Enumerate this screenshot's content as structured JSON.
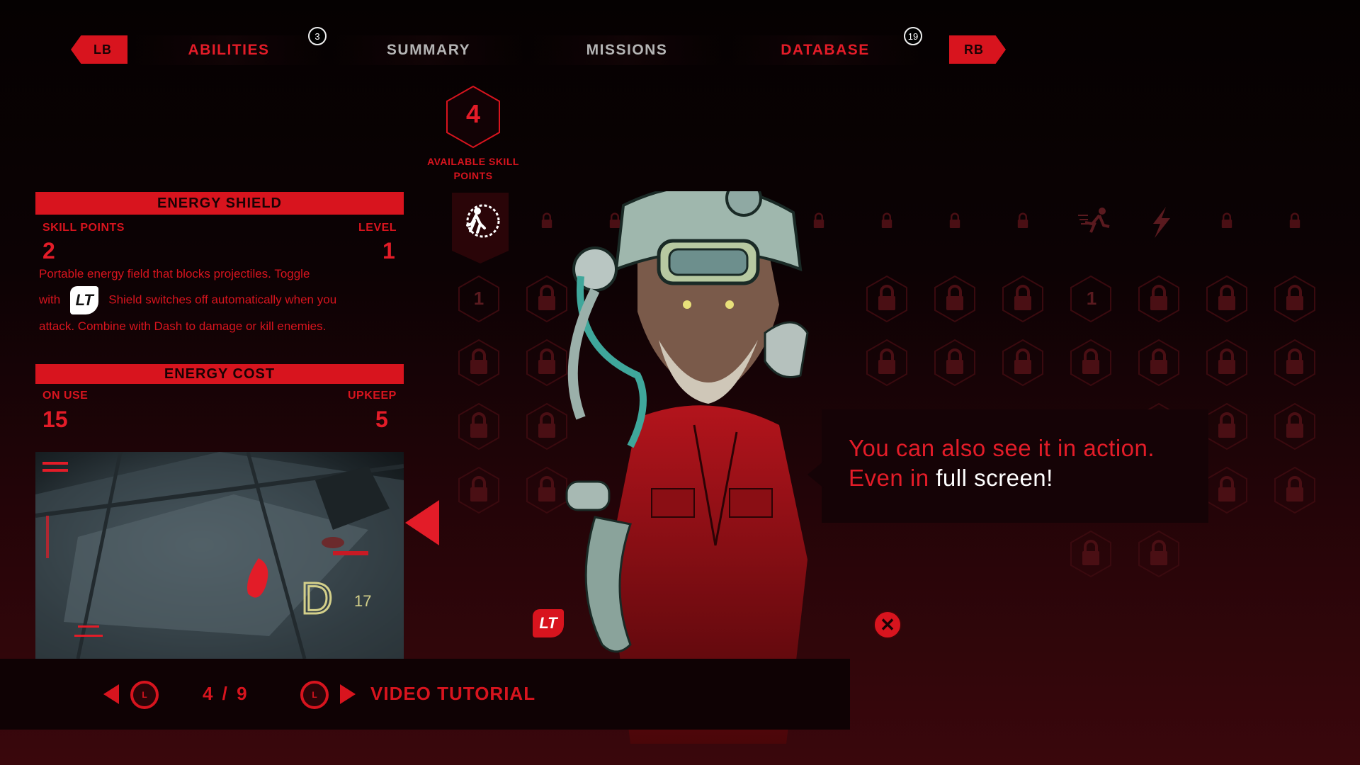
{
  "nav": {
    "lb": "LB",
    "rb": "RB",
    "tabs": [
      {
        "label": "ABILITIES",
        "badge": "3"
      },
      {
        "label": "SUMMARY",
        "badge": ""
      },
      {
        "label": "MISSIONS",
        "badge": ""
      },
      {
        "label": "DATABASE",
        "badge": "19"
      }
    ]
  },
  "skill_points": {
    "value": "4",
    "label": "AVAILABLE SKILL POINTS"
  },
  "ability": {
    "title": "ENERGY SHIELD",
    "skill_points_label": "SKILL POINTS",
    "skill_points_value": "2",
    "level_label": "LEVEL",
    "level_value": "1",
    "desc_part1": "Portable energy field that blocks projectiles. Toggle",
    "desc_with": "with",
    "desc_button": "LT",
    "desc_part2": "Shield switches off automatically when you",
    "desc_part3": "attack. Combine with Dash to damage or kill enemies."
  },
  "energy_cost": {
    "title": "ENERGY COST",
    "on_use_label": "ON USE",
    "on_use_value": "15",
    "upkeep_label": "UPKEEP",
    "upkeep_value": "5"
  },
  "video": {
    "overlay_letter": "D",
    "overlay_number": "17"
  },
  "tree": {
    "node_value_a": "1",
    "node_value_b": "1"
  },
  "dialog": {
    "line1": "You can also see it in action.",
    "line2_red": "Even in",
    "line2_white": "full screen!"
  },
  "bottom": {
    "stick_label": "L",
    "page": "4 / 9",
    "video_tutorial": "VIDEO TUTORIAL",
    "lt_button": "LT",
    "close": "✕"
  },
  "colors": {
    "accent": "#e31c28",
    "dark": "#1a0204"
  }
}
